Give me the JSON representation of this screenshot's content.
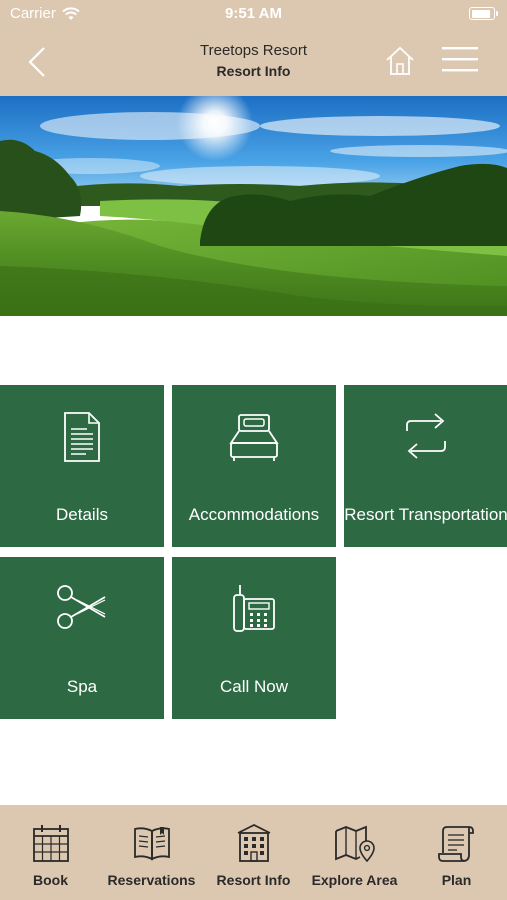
{
  "status_bar": {
    "carrier": "Carrier",
    "time": "9:51 AM",
    "battery_level": 0.9
  },
  "nav": {
    "title": "Treetops Resort",
    "subtitle": "Resort Info",
    "icons": [
      "chevron-left-icon",
      "home-icon",
      "hamburger-menu-icon"
    ]
  },
  "hero": {
    "description_icon": "golf-course-landscape"
  },
  "tiles": [
    {
      "label": "Details",
      "icon": "document-icon"
    },
    {
      "label": "Accommodations",
      "icon": "bed-icon"
    },
    {
      "label": "Resort Transportation",
      "icon": "transfer-arrows-icon"
    },
    {
      "label": "Spa",
      "icon": "scissors-icon"
    },
    {
      "label": "Call Now",
      "icon": "telephone-icon"
    }
  ],
  "tabbar": {
    "items": [
      {
        "label": "Book",
        "icon": "calendar-icon"
      },
      {
        "label": "Reservations",
        "icon": "open-book-icon"
      },
      {
        "label": "Resort Info",
        "icon": "building-icon"
      },
      {
        "label": "Explore Area",
        "icon": "map-pin-icon"
      },
      {
        "label": "Plan",
        "icon": "scroll-icon"
      }
    ]
  },
  "colors": {
    "header_bg": "#dcc8b0",
    "tile_bg": "#2d6a43",
    "text_dark": "#2a2a2a",
    "white": "#ffffff"
  }
}
